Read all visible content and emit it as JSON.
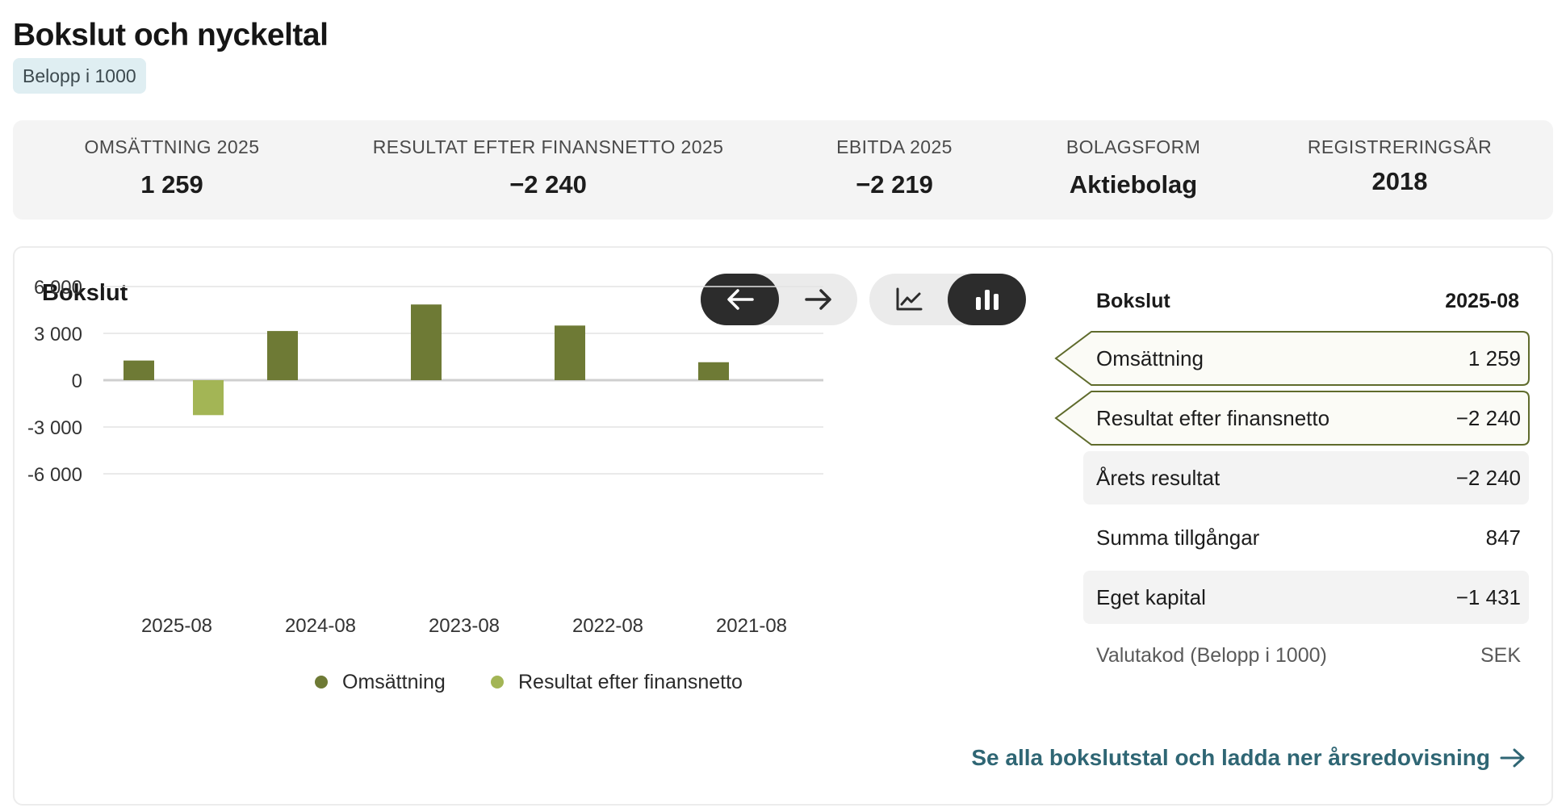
{
  "header": {
    "title": "Bokslut och nyckeltal",
    "unit_badge": "Belopp i 1000"
  },
  "kpis": [
    {
      "label": "OMSÄTTNING 2025",
      "value": "1 259"
    },
    {
      "label": "RESULTAT EFTER FINANSNETTO 2025",
      "value": "−2 240"
    },
    {
      "label": "EBITDA 2025",
      "value": "−2 219"
    },
    {
      "label": "BOLAGSFORM",
      "value": "Aktiebolag"
    },
    {
      "label": "REGISTRERINGSÅR",
      "value": "2018"
    }
  ],
  "chart_panel": {
    "title": "Bokslut",
    "nav": {
      "prev_icon": "arrow-left-icon",
      "next_icon": "arrow-right-icon",
      "active": "prev"
    },
    "view": {
      "line_icon": "line-chart-icon",
      "bar_icon": "bar-chart-icon",
      "active": "bar"
    }
  },
  "chart_data": {
    "type": "bar",
    "categories": [
      "2025-08",
      "2024-08",
      "2023-08",
      "2022-08",
      "2021-08"
    ],
    "series": [
      {
        "name": "Omsättning",
        "color": "#6e7a35",
        "values": [
          1259,
          3150,
          4850,
          3500,
          1150
        ]
      },
      {
        "name": "Resultat efter finansnetto",
        "color": "#a3b555",
        "values": [
          -2240,
          0,
          0,
          0,
          0
        ]
      }
    ],
    "y_ticks": [
      6000,
      3000,
      0,
      -3000,
      -6000
    ],
    "y_tick_labels": [
      "6 000",
      "3 000",
      "0",
      "-3 000",
      "-6 000"
    ],
    "ylim": [
      -6000,
      6000
    ],
    "grid": true,
    "legend_position": "bottom"
  },
  "detail": {
    "title": "Bokslut",
    "period": "2025-08",
    "rows": [
      {
        "label": "Omsättning",
        "value": "1 259",
        "state": "selected"
      },
      {
        "label": "Resultat efter finansnetto",
        "value": "−2 240",
        "state": "selected"
      },
      {
        "label": "Årets resultat",
        "value": "−2 240",
        "state": "shaded"
      },
      {
        "label": "Summa tillgångar",
        "value": "847",
        "state": "plain"
      },
      {
        "label": "Eget kapital",
        "value": "−1 431",
        "state": "shaded"
      }
    ],
    "currency": {
      "label": "Valutakod (Belopp i 1000)",
      "value": "SEK"
    },
    "selected_border_color": "#5f6b2c"
  },
  "footer_link": {
    "text": "Se alla bokslutstal och ladda ner årsredovisning",
    "icon": "arrow-right-icon"
  }
}
